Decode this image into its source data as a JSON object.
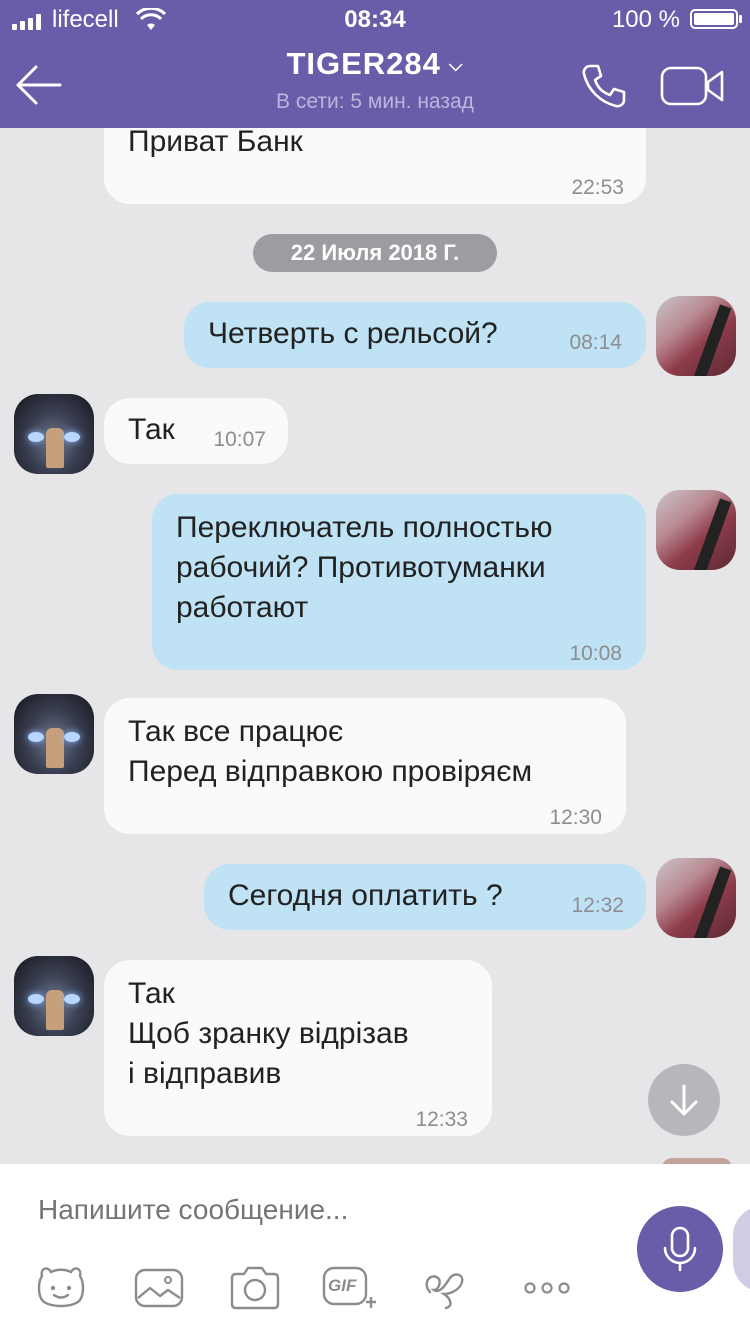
{
  "status_bar": {
    "carrier": "lifecell",
    "time": "08:34",
    "battery": "100 %"
  },
  "header": {
    "contact_name": "TIGER284",
    "status": "В сети: 5 мин. назад"
  },
  "date_separator": "22 Июля 2018 Г.",
  "messages": [
    {
      "side": "in",
      "lines": [
        "Приват Банк"
      ],
      "time": "22:53"
    },
    {
      "side": "out",
      "lines": [
        "Четверть с рельсой?"
      ],
      "time": "08:14"
    },
    {
      "side": "in",
      "lines": [
        "Так"
      ],
      "time": "10:07"
    },
    {
      "side": "out",
      "lines": [
        "Переключатель полностью",
        "рабочий? Противотуманки",
        "работают"
      ],
      "time": "10:08"
    },
    {
      "side": "in",
      "lines": [
        "Так все працює",
        "Перед відправкою провіряєм"
      ],
      "time": "12:30"
    },
    {
      "side": "out",
      "lines": [
        "Сегодня оплатить ?"
      ],
      "time": "12:32"
    },
    {
      "side": "in",
      "lines": [
        "Так",
        "Щоб зранку відрізав",
        "і відправив"
      ],
      "time": "12:33"
    }
  ],
  "composer": {
    "placeholder": "Напишите сообщение...",
    "gif_label": "GIF"
  },
  "colors": {
    "header": "#675da8",
    "incoming_bubble": "#fafafa",
    "outgoing_bubble": "#bfe2f4",
    "background": "#e6e6e8"
  },
  "icons": [
    "back-arrow-icon",
    "phone-icon",
    "video-camera-icon",
    "chevron-down-icon",
    "arrow-down-icon",
    "microphone-icon",
    "sticker-icon",
    "image-icon",
    "camera-icon",
    "gif-icon",
    "doodle-icon",
    "more-icon"
  ]
}
